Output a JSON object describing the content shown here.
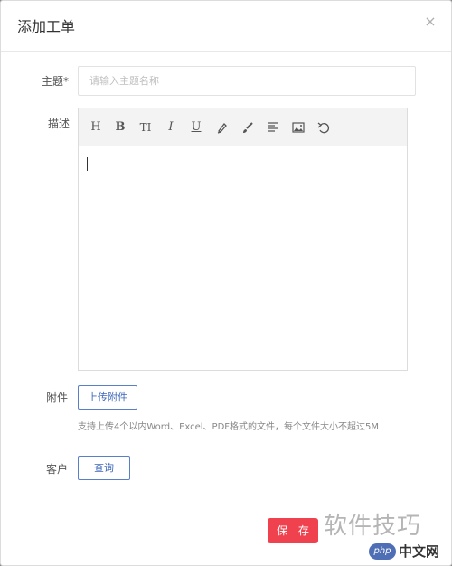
{
  "dialog": {
    "title": "添加工单",
    "close_glyph": "×"
  },
  "form": {
    "subject_label": "主题*",
    "subject_placeholder": "请输入主题名称",
    "subject_value": "",
    "description_label": "描述",
    "attachment_label": "附件",
    "upload_button": "上传附件",
    "attachment_hint": "支持上传4个以内Word、Excel、PDF格式的文件，每个文件大小不超过5M",
    "customer_label": "客户",
    "query_button": "查询",
    "save_button": "保 存"
  },
  "toolbar": {
    "heading": "H",
    "bold": "B",
    "font_size": "TI",
    "italic": "I",
    "underline": "U",
    "icons": [
      "heading-icon",
      "bold-icon",
      "font-size-icon",
      "italic-icon",
      "underline-icon",
      "highlighter-icon",
      "brush-icon",
      "align-left-icon",
      "image-icon",
      "undo-icon"
    ]
  },
  "watermark": {
    "text": "软件技巧",
    "badge": "php",
    "site": "中文网"
  },
  "colors": {
    "accent": "#f0414f",
    "outline_button": "#3e67b6"
  }
}
